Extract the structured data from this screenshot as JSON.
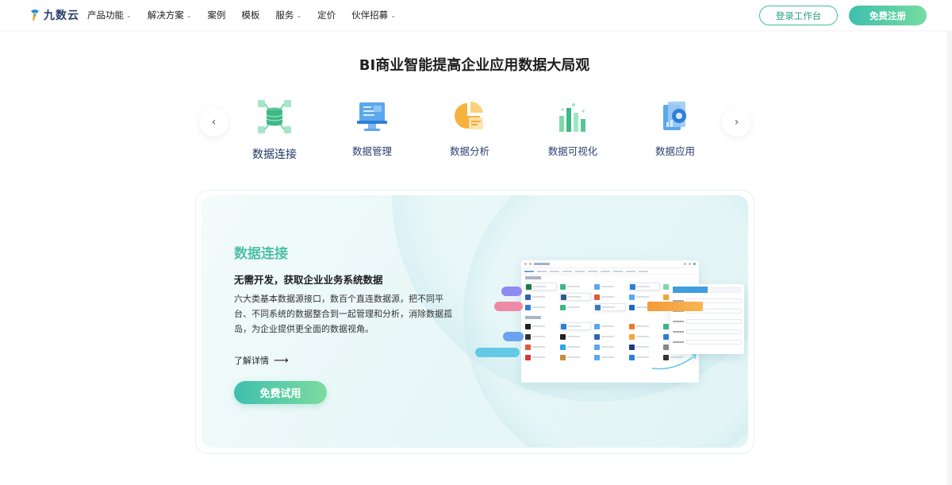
{
  "brand": {
    "name": "九数云"
  },
  "nav": {
    "items": [
      {
        "label": "产品功能",
        "has_dropdown": true
      },
      {
        "label": "解决方案",
        "has_dropdown": true
      },
      {
        "label": "案例",
        "has_dropdown": false
      },
      {
        "label": "模板",
        "has_dropdown": false
      },
      {
        "label": "服务",
        "has_dropdown": true
      },
      {
        "label": "定价",
        "has_dropdown": false
      },
      {
        "label": "伙伴招募",
        "has_dropdown": true
      }
    ],
    "login_label": "登录工作台",
    "register_label": "免费注册"
  },
  "section": {
    "title": "BI商业智能提高企业应用数据大局观"
  },
  "features": {
    "prev_icon": "chevron-left-icon",
    "next_icon": "chevron-right-icon",
    "items": [
      {
        "label": "数据连接",
        "icon": "database-connect-icon",
        "active": true
      },
      {
        "label": "数据管理",
        "icon": "data-management-icon",
        "active": false
      },
      {
        "label": "数据分析",
        "icon": "data-analysis-icon",
        "active": false
      },
      {
        "label": "数据可视化",
        "icon": "bar-chart-icon",
        "active": false
      },
      {
        "label": "数据应用",
        "icon": "data-application-icon",
        "active": false
      }
    ]
  },
  "card": {
    "title": "数据连接",
    "subtitle": "无需开发，获取企业业务系统数据",
    "description": "六大类基本数据源接口，数百个直连数据源，把不同平台、不同系统的数据整合到一起管理和分析，消除数据孤岛，为企业提供更全面的数据视角。",
    "more_label": "了解详情",
    "try_label": "免费试用"
  },
  "colors": {
    "accent": "#4ec0a6",
    "accent_gradient_end": "#7ddba0",
    "nav_text": "#222222",
    "feature_label": "#2a4170"
  }
}
